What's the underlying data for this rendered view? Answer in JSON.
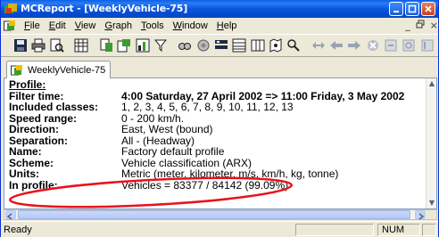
{
  "window": {
    "title": "MCReport - [WeeklyVehicle-75]",
    "title_bar_color": "#0a5fe6"
  },
  "menu": {
    "items": [
      {
        "label": "File",
        "underline": "F",
        "rest": "ile"
      },
      {
        "label": "Edit",
        "underline": "E",
        "rest": "dit"
      },
      {
        "label": "View",
        "underline": "V",
        "rest": "iew"
      },
      {
        "label": "Graph",
        "underline": "G",
        "rest": "raph"
      },
      {
        "label": "Tools",
        "underline": "T",
        "rest": "ools"
      },
      {
        "label": "Window",
        "underline": "W",
        "rest": "indow"
      },
      {
        "label": "Help",
        "underline": "H",
        "rest": "elp"
      }
    ],
    "mdi_minimize": "_",
    "mdi_restore": "&#x2750;",
    "mdi_close": "×"
  },
  "toolbar": {
    "icons": [
      "save-icon",
      "print-icon",
      "print-preview-icon",
      "grid-icon",
      "wizard-icon",
      "report-icon",
      "chart-icon",
      "filter-icon",
      "find-icon",
      "settings-icon",
      "layout-icon",
      "table-icon",
      "columns-icon",
      "map-icon",
      "arrow-both-icon",
      "arrow-left-icon",
      "arrow-right-icon",
      "stop-icon",
      "export-icon",
      "refresh-icon",
      "edit-icon"
    ]
  },
  "tab": {
    "label": "WeeklyVehicle-75"
  },
  "report": {
    "heading": "Profile:",
    "rows": [
      {
        "key": "Filter time:",
        "value": "4:00 Saturday, 27 April 2002 => 11:00 Friday, 3 May 2002",
        "bold": true
      },
      {
        "key": "Included classes:",
        "value": "1, 2, 3, 4, 5, 6, 7, 8, 9, 10, 11, 12, 13",
        "bold": false
      },
      {
        "key": "Speed range:",
        "value": "0 - 200 km/h.",
        "bold": false
      },
      {
        "key": "Direction:",
        "value": "East, West (bound)",
        "bold": false
      },
      {
        "key": "Separation:",
        "value": "All - (Headway)",
        "bold": false
      },
      {
        "key": "Name:",
        "value": "Factory default profile",
        "bold": false
      },
      {
        "key": "Scheme:",
        "value": "Vehicle classification (ARX)",
        "bold": false
      },
      {
        "key": "Units:",
        "value": "Metric (meter, kilometer, m/s, km/h, kg, tonne)",
        "bold": false
      },
      {
        "key": "In profile:",
        "value": "Vehicles = 83377 / 84142 (99.09%)",
        "bold": false
      }
    ]
  },
  "status": {
    "text": "Ready",
    "num": "NUM"
  },
  "annotation_color": "#e8131b"
}
